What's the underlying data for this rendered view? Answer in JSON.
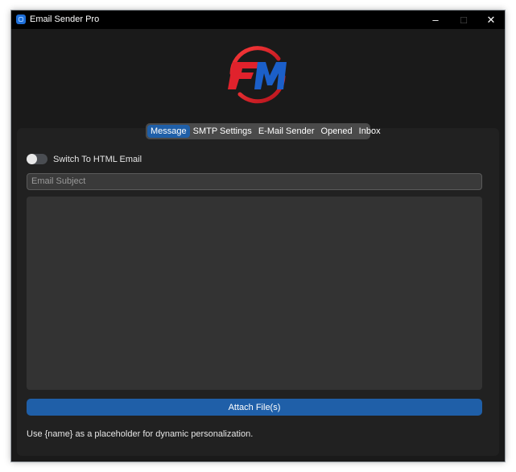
{
  "window": {
    "title": "Email Sender Pro",
    "icon": "app-window-icon"
  },
  "controls": {
    "minimize": "–",
    "maximize": "□",
    "close": "✕"
  },
  "logo": {
    "text": "FM",
    "colors": {
      "red": "#d8202a",
      "blue": "#1b5fc9"
    }
  },
  "tabs": [
    {
      "label": "Message",
      "active": true
    },
    {
      "label": "SMTP Settings",
      "active": false
    },
    {
      "label": "E-Mail Sender",
      "active": false
    },
    {
      "label": "Opened",
      "active": false
    },
    {
      "label": "Inbox",
      "active": false
    }
  ],
  "message": {
    "html_switch_label": "Switch To HTML Email",
    "html_switch_on": false,
    "subject_value": "",
    "subject_placeholder": "Email Subject",
    "body_value": "",
    "attach_label": "Attach File(s)",
    "hint": "Use {name} as a placeholder for dynamic personalization."
  },
  "colors": {
    "accent": "#1f5fa8",
    "background": "#1a1a1a",
    "panel": "#212121"
  }
}
